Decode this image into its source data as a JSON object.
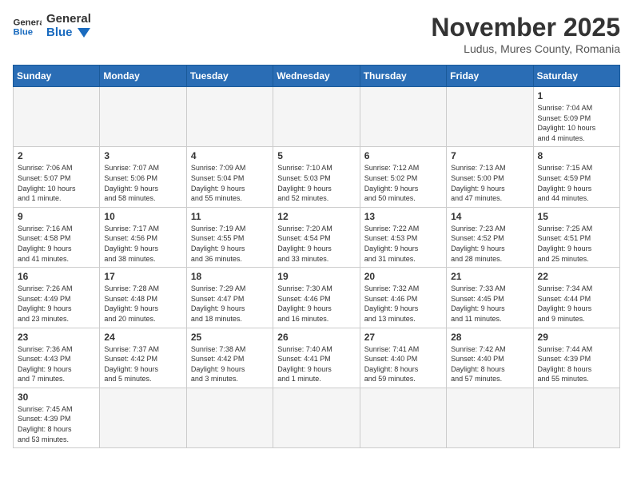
{
  "logo": {
    "text_general": "General",
    "text_blue": "Blue"
  },
  "header": {
    "title": "November 2025",
    "subtitle": "Ludus, Mures County, Romania"
  },
  "weekdays": [
    "Sunday",
    "Monday",
    "Tuesday",
    "Wednesday",
    "Thursday",
    "Friday",
    "Saturday"
  ],
  "weeks": [
    [
      {
        "day": "",
        "info": ""
      },
      {
        "day": "",
        "info": ""
      },
      {
        "day": "",
        "info": ""
      },
      {
        "day": "",
        "info": ""
      },
      {
        "day": "",
        "info": ""
      },
      {
        "day": "",
        "info": ""
      },
      {
        "day": "1",
        "info": "Sunrise: 7:04 AM\nSunset: 5:09 PM\nDaylight: 10 hours\nand 4 minutes."
      }
    ],
    [
      {
        "day": "2",
        "info": "Sunrise: 7:06 AM\nSunset: 5:07 PM\nDaylight: 10 hours\nand 1 minute."
      },
      {
        "day": "3",
        "info": "Sunrise: 7:07 AM\nSunset: 5:06 PM\nDaylight: 9 hours\nand 58 minutes."
      },
      {
        "day": "4",
        "info": "Sunrise: 7:09 AM\nSunset: 5:04 PM\nDaylight: 9 hours\nand 55 minutes."
      },
      {
        "day": "5",
        "info": "Sunrise: 7:10 AM\nSunset: 5:03 PM\nDaylight: 9 hours\nand 52 minutes."
      },
      {
        "day": "6",
        "info": "Sunrise: 7:12 AM\nSunset: 5:02 PM\nDaylight: 9 hours\nand 50 minutes."
      },
      {
        "day": "7",
        "info": "Sunrise: 7:13 AM\nSunset: 5:00 PM\nDaylight: 9 hours\nand 47 minutes."
      },
      {
        "day": "8",
        "info": "Sunrise: 7:15 AM\nSunset: 4:59 PM\nDaylight: 9 hours\nand 44 minutes."
      }
    ],
    [
      {
        "day": "9",
        "info": "Sunrise: 7:16 AM\nSunset: 4:58 PM\nDaylight: 9 hours\nand 41 minutes."
      },
      {
        "day": "10",
        "info": "Sunrise: 7:17 AM\nSunset: 4:56 PM\nDaylight: 9 hours\nand 38 minutes."
      },
      {
        "day": "11",
        "info": "Sunrise: 7:19 AM\nSunset: 4:55 PM\nDaylight: 9 hours\nand 36 minutes."
      },
      {
        "day": "12",
        "info": "Sunrise: 7:20 AM\nSunset: 4:54 PM\nDaylight: 9 hours\nand 33 minutes."
      },
      {
        "day": "13",
        "info": "Sunrise: 7:22 AM\nSunset: 4:53 PM\nDaylight: 9 hours\nand 31 minutes."
      },
      {
        "day": "14",
        "info": "Sunrise: 7:23 AM\nSunset: 4:52 PM\nDaylight: 9 hours\nand 28 minutes."
      },
      {
        "day": "15",
        "info": "Sunrise: 7:25 AM\nSunset: 4:51 PM\nDaylight: 9 hours\nand 25 minutes."
      }
    ],
    [
      {
        "day": "16",
        "info": "Sunrise: 7:26 AM\nSunset: 4:49 PM\nDaylight: 9 hours\nand 23 minutes."
      },
      {
        "day": "17",
        "info": "Sunrise: 7:28 AM\nSunset: 4:48 PM\nDaylight: 9 hours\nand 20 minutes."
      },
      {
        "day": "18",
        "info": "Sunrise: 7:29 AM\nSunset: 4:47 PM\nDaylight: 9 hours\nand 18 minutes."
      },
      {
        "day": "19",
        "info": "Sunrise: 7:30 AM\nSunset: 4:46 PM\nDaylight: 9 hours\nand 16 minutes."
      },
      {
        "day": "20",
        "info": "Sunrise: 7:32 AM\nSunset: 4:46 PM\nDaylight: 9 hours\nand 13 minutes."
      },
      {
        "day": "21",
        "info": "Sunrise: 7:33 AM\nSunset: 4:45 PM\nDaylight: 9 hours\nand 11 minutes."
      },
      {
        "day": "22",
        "info": "Sunrise: 7:34 AM\nSunset: 4:44 PM\nDaylight: 9 hours\nand 9 minutes."
      }
    ],
    [
      {
        "day": "23",
        "info": "Sunrise: 7:36 AM\nSunset: 4:43 PM\nDaylight: 9 hours\nand 7 minutes."
      },
      {
        "day": "24",
        "info": "Sunrise: 7:37 AM\nSunset: 4:42 PM\nDaylight: 9 hours\nand 5 minutes."
      },
      {
        "day": "25",
        "info": "Sunrise: 7:38 AM\nSunset: 4:42 PM\nDaylight: 9 hours\nand 3 minutes."
      },
      {
        "day": "26",
        "info": "Sunrise: 7:40 AM\nSunset: 4:41 PM\nDaylight: 9 hours\nand 1 minute."
      },
      {
        "day": "27",
        "info": "Sunrise: 7:41 AM\nSunset: 4:40 PM\nDaylight: 8 hours\nand 59 minutes."
      },
      {
        "day": "28",
        "info": "Sunrise: 7:42 AM\nSunset: 4:40 PM\nDaylight: 8 hours\nand 57 minutes."
      },
      {
        "day": "29",
        "info": "Sunrise: 7:44 AM\nSunset: 4:39 PM\nDaylight: 8 hours\nand 55 minutes."
      }
    ],
    [
      {
        "day": "30",
        "info": "Sunrise: 7:45 AM\nSunset: 4:39 PM\nDaylight: 8 hours\nand 53 minutes."
      },
      {
        "day": "",
        "info": ""
      },
      {
        "day": "",
        "info": ""
      },
      {
        "day": "",
        "info": ""
      },
      {
        "day": "",
        "info": ""
      },
      {
        "day": "",
        "info": ""
      },
      {
        "day": "",
        "info": ""
      }
    ]
  ]
}
